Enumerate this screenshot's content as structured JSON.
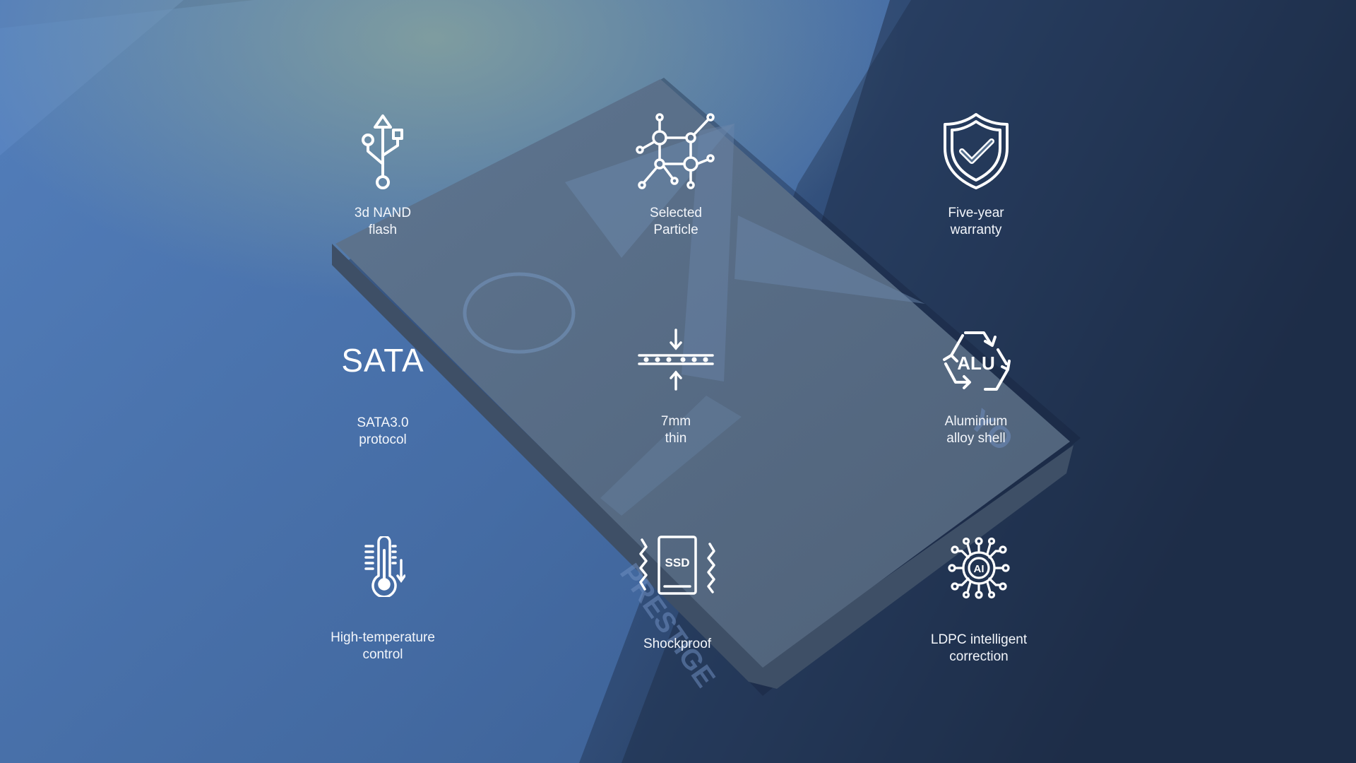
{
  "colors": {
    "background_left": "#4a72ad",
    "background_right": "#1c2b45",
    "drive_face": "#566a82",
    "icon": "#ffffff"
  },
  "device": {
    "brand_text": "PRESTIGE",
    "logo_text": "YO"
  },
  "features": [
    {
      "id": "nand",
      "icon": "usb-icon",
      "label": "3d NAND\nflash"
    },
    {
      "id": "particle",
      "icon": "network-nodes-icon",
      "label": "Selected\nParticle"
    },
    {
      "id": "warranty",
      "icon": "shield-check-icon",
      "label": "Five-year\nwarranty"
    },
    {
      "id": "sata",
      "icon": "sata-text-icon",
      "icon_text": "SATA",
      "label": "SATA3.0\nprotocol"
    },
    {
      "id": "thin",
      "icon": "thin-compress-icon",
      "label": "7mm\nthin"
    },
    {
      "id": "alu",
      "icon": "recycle-alu-icon",
      "icon_text": "ALU",
      "label": "Aluminium\nalloy shell"
    },
    {
      "id": "temp",
      "icon": "thermometer-icon",
      "label": "High-temperature\ncontrol"
    },
    {
      "id": "shock",
      "icon": "ssd-shock-icon",
      "icon_text": "SSD",
      "label": "Shockproof"
    },
    {
      "id": "ldpc",
      "icon": "ai-chip-icon",
      "icon_text": "AI",
      "label": "LDPC intelligent\ncorrection"
    }
  ]
}
